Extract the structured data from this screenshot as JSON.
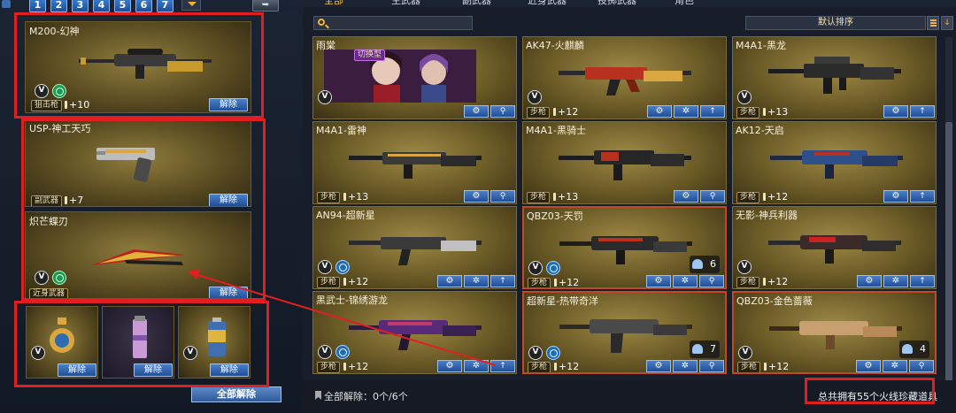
{
  "loadout_tabs": [
    "1",
    "2",
    "3",
    "4",
    "5",
    "6",
    "7"
  ],
  "left_slots": {
    "primary": {
      "name": "M200-幻神",
      "category": "狙击枪",
      "level": "+10",
      "unequip": "解除"
    },
    "secondary": {
      "name": "USP-神工天巧",
      "category": "副武器",
      "level": "+7",
      "unequip": "解除"
    },
    "melee": {
      "name": "炽芒蝶刃",
      "category": "近身武器",
      "unequip": "解除"
    },
    "throwables": [
      {
        "unequip": "解除"
      },
      {
        "unequip": "解除"
      },
      {
        "unequip": "解除"
      }
    ]
  },
  "unequip_all": "全部解除",
  "top_tabs": [
    "全部",
    "主武器",
    "副武器",
    "近身武器",
    "投掷武器",
    "角色"
  ],
  "sort_label": "默认排序",
  "cards": [
    {
      "title": "雨棠",
      "type": "character",
      "tag": "切换型"
    },
    {
      "title": "AK47-火麒麟",
      "category": "步枪",
      "level": "+12"
    },
    {
      "title": "M4A1-黑龙",
      "category": "步枪",
      "level": "+13"
    },
    {
      "title": "M4A1-雷神",
      "category": "步枪",
      "level": "+13"
    },
    {
      "title": "M4A1-黑骑士",
      "category": "步枪",
      "level": "+13"
    },
    {
      "title": "AK12-天启",
      "category": "步枪",
      "level": "+12"
    },
    {
      "title": "AN94-超新星",
      "category": "步枪",
      "level": "+12"
    },
    {
      "title": "QBZ03-天罚",
      "category": "步枪",
      "level": "+12",
      "count": "6"
    },
    {
      "title": "无影-神兵利器",
      "category": "步枪",
      "level": "+12"
    },
    {
      "title": "黑武士-锦绣游龙",
      "category": "步枪",
      "level": "+12"
    },
    {
      "title": "超新星-热带奇洋",
      "category": "步枪",
      "level": "+12",
      "count": "7"
    },
    {
      "title": "QBZ03-金色蔷薇",
      "category": "步枪",
      "level": "+12",
      "count": "4"
    }
  ],
  "unequip_count": "全部解除：0个/6个",
  "owned_total": "总共拥有55个火线珍藏道具",
  "colors": {
    "highlight_red": "#e02020",
    "gold_card": "#8f7c3c",
    "button_blue": "#2f5a9a"
  }
}
